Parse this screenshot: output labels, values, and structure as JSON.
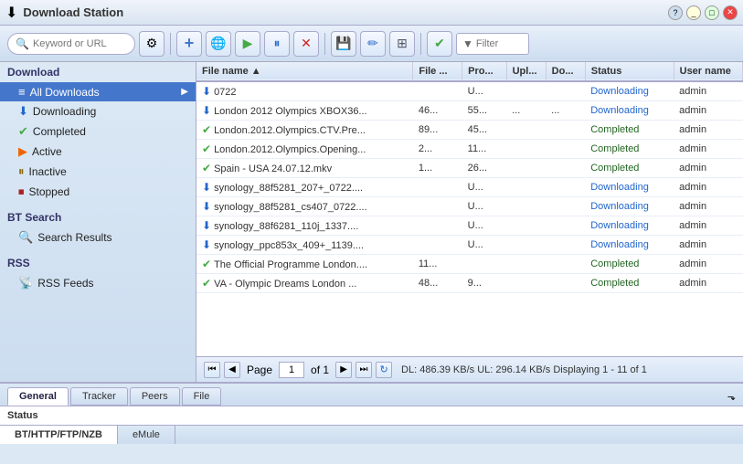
{
  "titlebar": {
    "title": "Download Station",
    "app_icon": "⬇",
    "buttons": {
      "help": "?",
      "min": "_",
      "max": "□",
      "close": "✕"
    }
  },
  "toolbar": {
    "search_placeholder": "Keyword or URL",
    "filter_placeholder": "Filter",
    "buttons": {
      "settings": "⚙",
      "add": "+",
      "globe": "🌐",
      "play": "▶",
      "pause": "⏸",
      "stop": "✕",
      "save": "💾",
      "edit": "✏",
      "grid": "⊞",
      "check": "✔",
      "filter": "▼"
    }
  },
  "sidebar": {
    "download_section": "Download",
    "items": [
      {
        "id": "all",
        "label": "All Downloads",
        "icon": "≡",
        "active": true
      },
      {
        "id": "downloading",
        "label": "Downloading",
        "icon": "⬇",
        "active": false
      },
      {
        "id": "completed",
        "label": "Completed",
        "icon": "✔",
        "active": false
      },
      {
        "id": "active",
        "label": "Active",
        "icon": "▶",
        "active": false
      },
      {
        "id": "inactive",
        "label": "Inactive",
        "icon": "⏸",
        "active": false
      },
      {
        "id": "stopped",
        "label": "Stopped",
        "icon": "⏹",
        "active": false
      }
    ],
    "bt_section": "BT Search",
    "bt_items": [
      {
        "id": "search",
        "label": "Search Results",
        "icon": "🔍"
      }
    ],
    "rss_section": "RSS",
    "rss_items": [
      {
        "id": "rss",
        "label": "RSS Feeds",
        "icon": "📡"
      }
    ]
  },
  "table": {
    "columns": [
      {
        "id": "filename",
        "label": "File name ▲"
      },
      {
        "id": "filesize",
        "label": "File ..."
      },
      {
        "id": "progress",
        "label": "Pro..."
      },
      {
        "id": "upload",
        "label": "Upl..."
      },
      {
        "id": "download",
        "label": "Do..."
      },
      {
        "id": "status",
        "label": "Status"
      },
      {
        "id": "username",
        "label": "User name"
      }
    ],
    "rows": [
      {
        "name": "0722",
        "size": "",
        "progress": "U...",
        "upload": "",
        "download": "",
        "status": "Downloading",
        "user": "admin",
        "type": "downloading"
      },
      {
        "name": "London 2012 Olympics XBOX36...",
        "size": "46...",
        "progress": "55...",
        "upload": "...",
        "download": "...",
        "status": "Downloading",
        "user": "admin",
        "type": "downloading"
      },
      {
        "name": "London.2012.Olympics.CTV.Pre...",
        "size": "89...",
        "progress": "45...",
        "upload": "",
        "download": "",
        "status": "Completed",
        "user": "admin",
        "type": "completed"
      },
      {
        "name": "London.2012.Olympics.Opening...",
        "size": "2...",
        "progress": "11...",
        "upload": "",
        "download": "",
        "status": "Completed",
        "user": "admin",
        "type": "completed"
      },
      {
        "name": "Spain - USA 24.07.12.mkv",
        "size": "1...",
        "progress": "26...",
        "upload": "",
        "download": "",
        "status": "Completed",
        "user": "admin",
        "type": "completed"
      },
      {
        "name": "synology_88f5281_207+_0722....",
        "size": "",
        "progress": "U...",
        "upload": "",
        "download": "",
        "status": "Downloading",
        "user": "admin",
        "type": "downloading"
      },
      {
        "name": "synology_88f5281_cs407_0722....",
        "size": "",
        "progress": "U...",
        "upload": "",
        "download": "",
        "status": "Downloading",
        "user": "admin",
        "type": "downloading"
      },
      {
        "name": "synology_88f6281_110j_1337....",
        "size": "",
        "progress": "U...",
        "upload": "",
        "download": "",
        "status": "Downloading",
        "user": "admin",
        "type": "downloading"
      },
      {
        "name": "synology_ppc853x_409+_1139....",
        "size": "",
        "progress": "U...",
        "upload": "",
        "download": "",
        "status": "Downloading",
        "user": "admin",
        "type": "downloading"
      },
      {
        "name": "The Official Programme London....",
        "size": "11...",
        "progress": "",
        "upload": "",
        "download": "",
        "status": "Completed",
        "user": "admin",
        "type": "completed"
      },
      {
        "name": "VA - Olympic Dreams London ...",
        "size": "48...",
        "progress": "9...",
        "upload": "",
        "download": "",
        "status": "Completed",
        "user": "admin",
        "type": "completed"
      }
    ]
  },
  "pagination": {
    "first": "⏮",
    "prev": "◀",
    "page_label": "Page",
    "page_value": "1",
    "of_label": "of 1",
    "next": "▶",
    "last": "⏭",
    "refresh": "↻",
    "status_text": "DL: 486.39 KB/s  UL: 296.14 KB/s  Displaying 1 - 11 of 1"
  },
  "bottom_panel": {
    "tabs": [
      {
        "id": "general",
        "label": "General",
        "active": true
      },
      {
        "id": "tracker",
        "label": "Tracker",
        "active": false
      },
      {
        "id": "peers",
        "label": "Peers",
        "active": false
      },
      {
        "id": "file",
        "label": "File",
        "active": false
      }
    ],
    "status_label": "Status",
    "expand_icon": "⬎"
  },
  "protocol_tabs": [
    {
      "id": "bt",
      "label": "BT/HTTP/FTP/NZB",
      "active": true
    },
    {
      "id": "emule",
      "label": "eMule",
      "active": false
    }
  ]
}
